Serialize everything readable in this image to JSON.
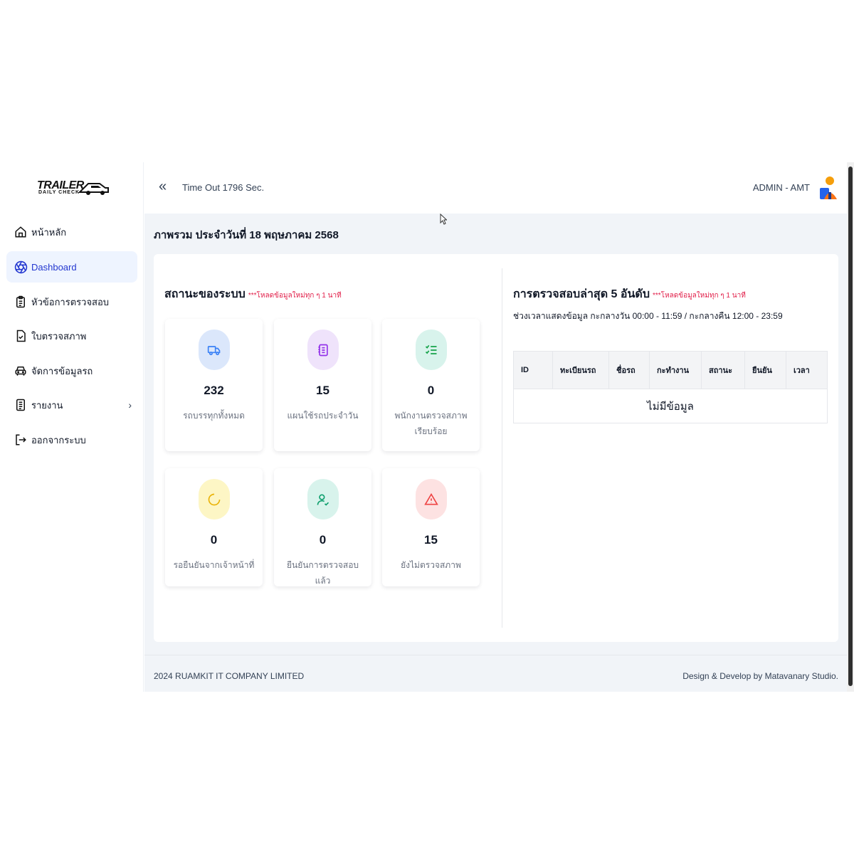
{
  "brand": {
    "logo_line1": "TRAILER",
    "logo_line2": "DAILY CHECK"
  },
  "sidebar": {
    "items": [
      {
        "label": "หน้าหลัก",
        "icon": "home-icon"
      },
      {
        "label": "Dashboard",
        "icon": "aperture-icon",
        "active": true
      },
      {
        "label": "หัวข้อการตรวจสอบ",
        "icon": "clipboard-list-icon"
      },
      {
        "label": "ใบตรวจสภาพ",
        "icon": "file-check-icon"
      },
      {
        "label": "จัดการข้อมูลรถ",
        "icon": "car-icon"
      },
      {
        "label": "รายงาน",
        "icon": "report-icon",
        "has_submenu": true
      },
      {
        "label": "ออกจากระบบ",
        "icon": "logout-icon"
      }
    ]
  },
  "header": {
    "timeout_text": "Time Out 1796 Sec.",
    "user_name": "ADMIN - AMT"
  },
  "page": {
    "title": "ภาพรวม ประจำวันที่ 18 พฤษภาคม 2568"
  },
  "status": {
    "title": "สถานะของระบบ",
    "note": "***โหลดข้อมูลใหม่ทุก ๆ 1 นาที",
    "cards": [
      {
        "value": "232",
        "caption": "รถบรรทุกทั้งหมด",
        "icon": "truck-icon",
        "color": "#dbe7fb",
        "icon_color": "#3b82f6"
      },
      {
        "value": "15",
        "caption": "แผนใช้รถประจำวัน",
        "icon": "notebook-icon",
        "color": "#efe3fb",
        "icon_color": "#9333ea"
      },
      {
        "value": "0",
        "caption": "พนักงานตรวจสภาพเรียบร้อย",
        "icon": "checklist-icon",
        "color": "#d8f3ec",
        "icon_color": "#16a34a"
      },
      {
        "value": "0",
        "caption": "รอยืนยันจากเจ้าหน้าที่",
        "icon": "loading-icon",
        "color": "#fdf6c5",
        "icon_color": "#eab308"
      },
      {
        "value": "0",
        "caption": "ยืนยันการตรวจสอบแล้ว",
        "icon": "user-check-icon",
        "color": "#d8f3ec",
        "icon_color": "#0f9f6e"
      },
      {
        "value": "15",
        "caption": "ยังไม่ตรวจสภาพ",
        "icon": "warning-icon",
        "color": "#fde2e2",
        "icon_color": "#ef4444"
      }
    ]
  },
  "latest": {
    "title": "การตรวจสอบล่าสุด 5 อันดับ",
    "note": "***โหลดข้อมูลใหม่ทุก ๆ 1 นาที",
    "subtitle": "ช่วงเวลาแสดงข้อมูล กะกลางวัน 00:00 - 11:59 / กะกลางคืน 12:00 - 23:59",
    "columns": [
      "ID",
      "ทะเบียนรถ",
      "ชื่อรถ",
      "กะทำงาน",
      "สถานะ",
      "ยืนยัน",
      "เวลา"
    ],
    "empty_text": "ไม่มีข้อมูล"
  },
  "footer": {
    "left": "2024 RUAMKIT IT COMPANY LIMITED",
    "right": "Design & Develop by Matavanary Studio."
  }
}
